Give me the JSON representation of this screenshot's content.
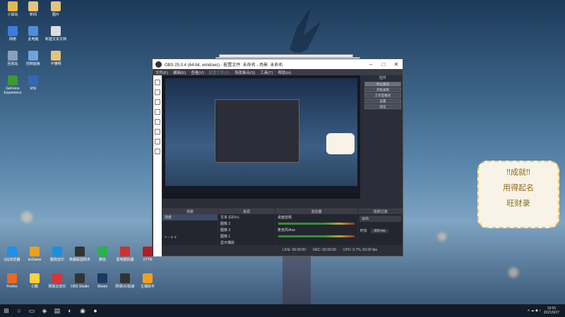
{
  "desktop": {
    "icons_left": [
      {
        "label": "小鼠站",
        "color": "#e6b84b"
      },
      {
        "label": "网络",
        "color": "#3d7be0"
      },
      {
        "label": "回收站",
        "color": "#8aa0b8"
      },
      {
        "label": "GeForce Experience",
        "color": "#3b9a2c"
      }
    ],
    "icons_col2": [
      {
        "label": "新闻",
        "color": "#e6c37a"
      },
      {
        "label": "此电脑",
        "color": "#4d8ed8"
      },
      {
        "label": "控制面板",
        "color": "#6fa4da"
      },
      {
        "label": "MSI",
        "color": "#3566b8"
      }
    ],
    "icons_col3": [
      {
        "label": "图片",
        "color": "#e6c37a"
      },
      {
        "label": "新建文本文档",
        "color": "#ddd"
      },
      {
        "label": "不懂啊",
        "color": "#e6c37a"
      }
    ],
    "bottom_row1": [
      {
        "label": "QQ浏览器",
        "color": "#1f8fe8"
      },
      {
        "label": "dcGame",
        "color": "#e8a020"
      },
      {
        "label": "酷狗音乐",
        "color": "#1a8fe0"
      },
      {
        "label": "英雄联盟助手",
        "color": "#333"
      },
      {
        "label": "微信",
        "color": "#2ab24a"
      },
      {
        "label": "雷电模拟器",
        "color": "#d03030"
      },
      {
        "label": "XTTN",
        "color": "#b02020"
      }
    ],
    "bottom_row2": [
      {
        "label": "Firefox",
        "color": "#e66a22"
      },
      {
        "label": "小酷",
        "color": "#ffd140"
      },
      {
        "label": "网易云音乐",
        "color": "#d33"
      },
      {
        "label": "OBS Studio",
        "color": "#333"
      },
      {
        "label": "Steam",
        "color": "#1b3a5c"
      },
      {
        "label": "网易UU加速",
        "color": "#333"
      },
      {
        "label": "主播助手",
        "color": "#f2a020"
      }
    ]
  },
  "sticker": {
    "line1": "‼成就‼",
    "line2": "用得起名",
    "line3": "旺财录"
  },
  "obs": {
    "title": "OBS 25.0.4 (64-bit, windows) - 配置文件: 未命名 - 场景: 未命名",
    "menu": [
      "文件(F)",
      "编辑(E)",
      "查看(V)",
      "配置文件(P)",
      "场景集合(S)",
      "工具(T)",
      "帮助(H)"
    ],
    "controls_header": "控件",
    "controls": [
      "停止推流",
      "开始录制",
      "工作室模式",
      "设置",
      "退出"
    ],
    "docks": {
      "scenes": {
        "header": "场景",
        "items": [
          "场景"
        ]
      },
      "sources": {
        "header": "来源",
        "items": [
          "文本 (GDI+)",
          "图像 2",
          "图像 3",
          "图像 1",
          "显示捕获"
        ]
      },
      "mixer": {
        "header": "混音器",
        "channels": [
          "桌面音频",
          "麦克风/Aux"
        ]
      },
      "transitions": {
        "header": "场景过渡",
        "value": "淡出",
        "duration_label": "时长",
        "duration": "300 ms"
      }
    },
    "status": {
      "live": "LIVE: 00:00:00",
      "rec": "REC: 00:00:00",
      "cpu": "CPU: 0.7%, 60.00 fps"
    }
  },
  "taskbar": {
    "time": "19:55",
    "date": "2021/9/27"
  }
}
